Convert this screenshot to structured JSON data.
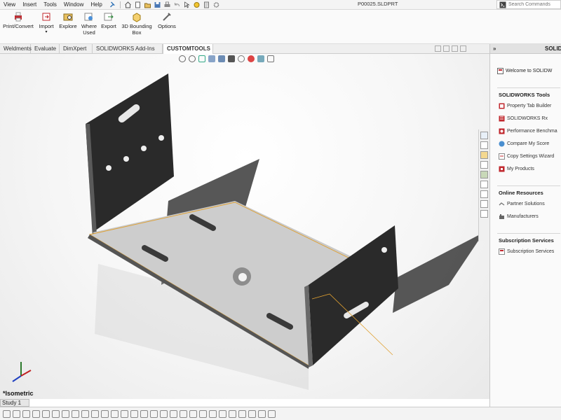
{
  "menu": {
    "items": [
      "View",
      "Insert",
      "Tools",
      "Window",
      "Help"
    ],
    "pin_icon": "pin-icon"
  },
  "title_bar": {
    "document": "P00025.SLDPRT"
  },
  "search": {
    "placeholder": "Search Commands"
  },
  "ribbon": {
    "buttons": [
      {
        "label": "Print/Convert",
        "icon": "print-convert-icon"
      },
      {
        "label": "Import",
        "icon": "import-icon"
      },
      {
        "label": "Explore",
        "icon": "explore-icon"
      },
      {
        "label": "Where\nUsed",
        "icon": "where-used-icon"
      },
      {
        "label": "Export",
        "icon": "export-icon"
      },
      {
        "label": "3D Bounding\nBox",
        "icon": "bounding-box-icon"
      },
      {
        "label": "Options",
        "icon": "options-icon"
      }
    ]
  },
  "tabs": [
    "Weldments",
    "Evaluate",
    "DimXpert",
    "SOLIDWORKS Add-Ins",
    "CUSTOMTOOLS"
  ],
  "active_tab": "CUSTOMTOOLS",
  "viewport": {
    "view_label": "*Isometric"
  },
  "bottom": {
    "study_tab": "Study 1"
  },
  "task_pane": {
    "title": "SOLID",
    "welcome": "Welcome to SOLIDW",
    "sections": [
      {
        "title": "SOLIDWORKS Tools",
        "items": [
          "Property Tab Builder",
          "SOLIDWORKS Rx",
          "Performance Benchma",
          "Compare My Score",
          "Copy Settings Wizard",
          "My Products"
        ]
      },
      {
        "title": "Online Resources",
        "items": [
          "Partner Solutions",
          "Manufacturers"
        ]
      },
      {
        "title": "Subscription Services",
        "items": [
          "Subscription Services"
        ]
      }
    ]
  },
  "colors": {
    "part_dark": "#2b2b2b",
    "part_face": "#c9c9c9",
    "edge_highlight": "#e0a030",
    "accent_red": "#c0282e"
  }
}
